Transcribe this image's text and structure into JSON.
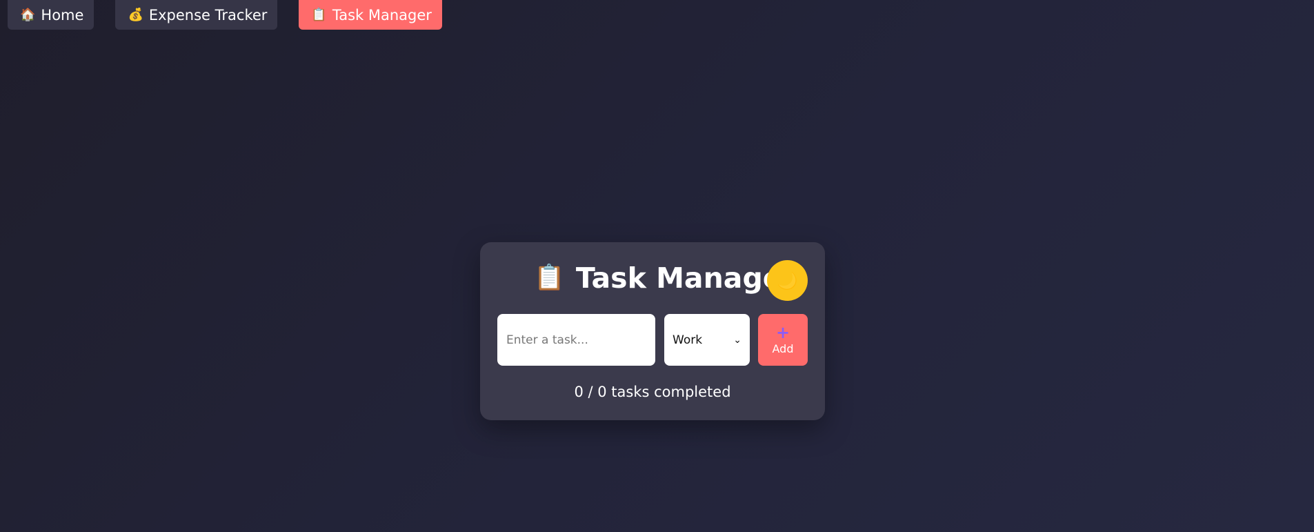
{
  "nav": {
    "items": [
      {
        "icon": "🏠",
        "icon_name": "house-icon",
        "label": "Home"
      },
      {
        "icon": "💰",
        "icon_name": "money-bag-icon",
        "label": "Expense Tracker"
      },
      {
        "icon": "📋",
        "icon_name": "clipboard-icon",
        "label": "Task Manager"
      }
    ],
    "active": "Task Manager"
  },
  "card": {
    "title_icon": "📋",
    "title_icon_name": "clipboard-icon",
    "title": "Task Manager",
    "theme_toggle_icon": "🌙",
    "theme_toggle_icon_name": "moon-icon",
    "task_input": {
      "placeholder": "Enter a task...",
      "value": ""
    },
    "category_select": {
      "selected": "Work"
    },
    "add_button": {
      "icon": "+",
      "icon_name": "plus-icon",
      "label": "Add"
    },
    "progress_text": "0 / 0 tasks completed"
  },
  "colors": {
    "accent": "#ff6b6b",
    "toggle": "#fcc419",
    "card_bg": "#3b3a4c",
    "nav_bg": "#363547",
    "page_bg": "#23243a",
    "plus_icon": "#8b5cf6"
  }
}
